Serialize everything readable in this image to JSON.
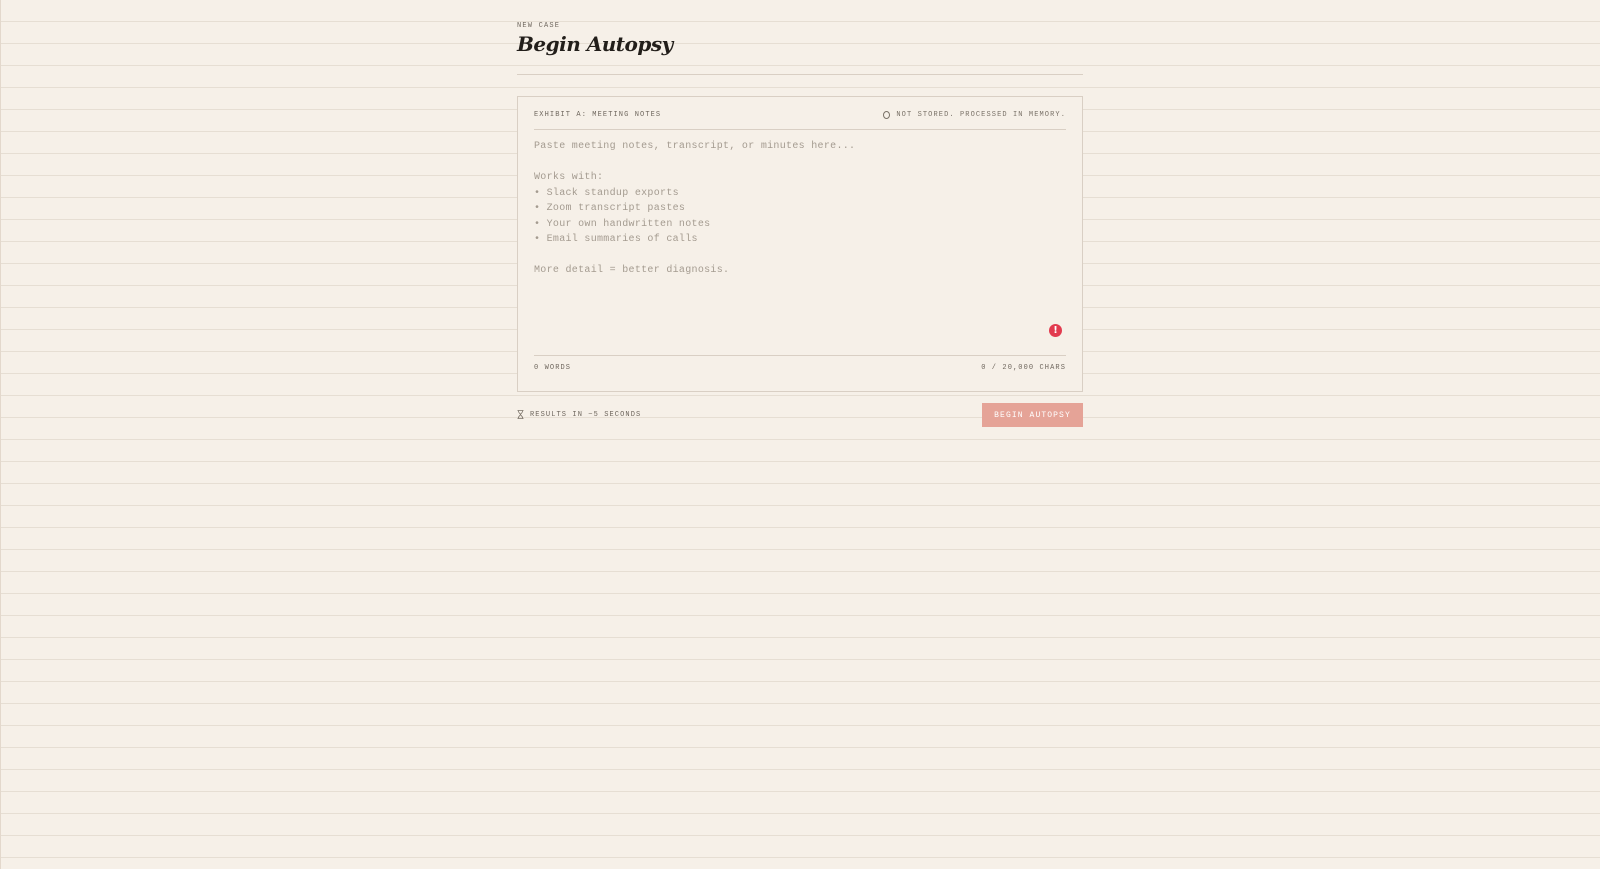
{
  "header": {
    "eyebrow": "NEW CASE",
    "title": "Begin Autopsy"
  },
  "panel": {
    "exhibit_label": "EXHIBIT A: MEETING NOTES",
    "privacy_note": "NOT STORED. PROCESSED IN MEMORY.",
    "notes_value": "",
    "notes_placeholder": "Paste meeting notes, transcript, or minutes here...\n\nWorks with:\n• Slack standup exports\n• Zoom transcript pastes\n• Your own handwritten notes\n• Email summaries of calls\n\nMore detail = better diagnosis.",
    "word_count": "0 WORDS",
    "char_count": "0 / 20,000 CHARS"
  },
  "footer": {
    "eta": "RESULTS IN ~5 SECONDS",
    "submit_label": "BEGIN AUTOPSY"
  },
  "icons": {
    "privacy": "circle-icon",
    "alert": "alert-icon",
    "eta": "hourglass-icon"
  },
  "colors": {
    "background": "#f6f0e8",
    "button": "#e5a397",
    "alert": "#e23b4f"
  }
}
